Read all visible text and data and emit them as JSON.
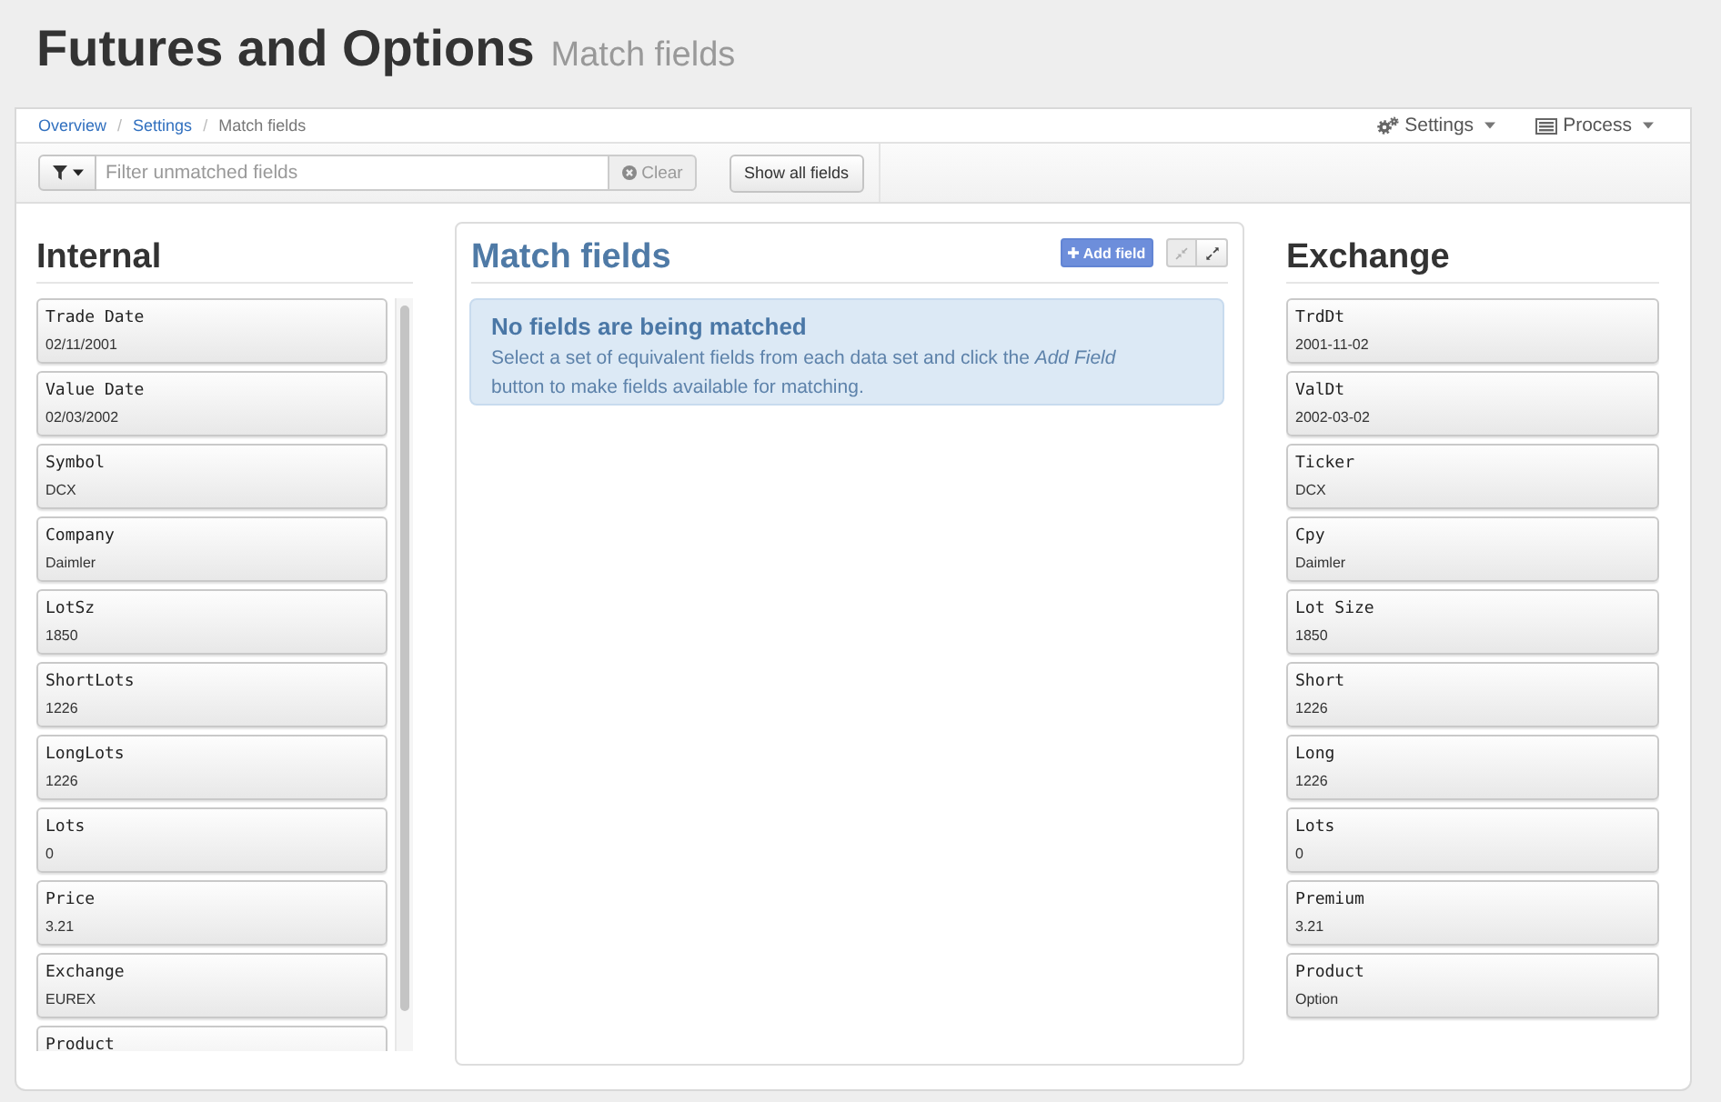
{
  "header": {
    "title": "Futures and Options",
    "subtitle": "Match fields"
  },
  "breadcrumb": {
    "separator": "/",
    "items": [
      {
        "label": "Overview",
        "kind": "link"
      },
      {
        "label": "Settings",
        "kind": "link"
      },
      {
        "label": "Match fields",
        "kind": "current"
      }
    ]
  },
  "settings_menu": {
    "label": "Settings"
  },
  "process_menu": {
    "label": "Process"
  },
  "toolbar": {
    "filter": {
      "placeholder": "Filter unmatched fields"
    },
    "clear_button": "Clear",
    "show_all_button": "Show all fields"
  },
  "internal": {
    "title": "Internal",
    "fields": [
      {
        "name": "Trade Date",
        "value": "02/11/2001"
      },
      {
        "name": "Value Date",
        "value": "02/03/2002"
      },
      {
        "name": "Symbol",
        "value": "DCX"
      },
      {
        "name": "Company",
        "value": "Daimler"
      },
      {
        "name": "LotSz",
        "value": "1850"
      },
      {
        "name": "ShortLots",
        "value": "1226"
      },
      {
        "name": "LongLots",
        "value": "1226"
      },
      {
        "name": "Lots",
        "value": "0"
      },
      {
        "name": "Price",
        "value": "3.21"
      },
      {
        "name": "Exchange",
        "value": "EUREX"
      },
      {
        "name": "Product"
      }
    ]
  },
  "match_panel": {
    "title": "Match fields",
    "add_button": "Add field",
    "size_buttons": [
      {
        "kind": "compress",
        "disabled": true
      },
      {
        "kind": "expand",
        "disabled": false
      }
    ],
    "alert": {
      "heading": "No fields are being matched",
      "text": "Select a set of equivalent fields from each data set and click the *Add Field* button to make fields available for matching."
    }
  },
  "exchange": {
    "title": "Exchange",
    "fields": [
      {
        "name": "TrdDt",
        "value": "2001-11-02"
      },
      {
        "name": "ValDt",
        "value": "2002-03-02"
      },
      {
        "name": "Ticker",
        "value": "DCX"
      },
      {
        "name": "Cpy",
        "value": "Daimler"
      },
      {
        "name": "Lot Size",
        "value": "1850"
      },
      {
        "name": "Short",
        "value": "1226"
      },
      {
        "name": "Long",
        "value": "1226"
      },
      {
        "name": "Lots",
        "value": "0"
      },
      {
        "name": "Premium",
        "value": "3.21"
      },
      {
        "name": "Product",
        "value": "Option"
      }
    ]
  }
}
